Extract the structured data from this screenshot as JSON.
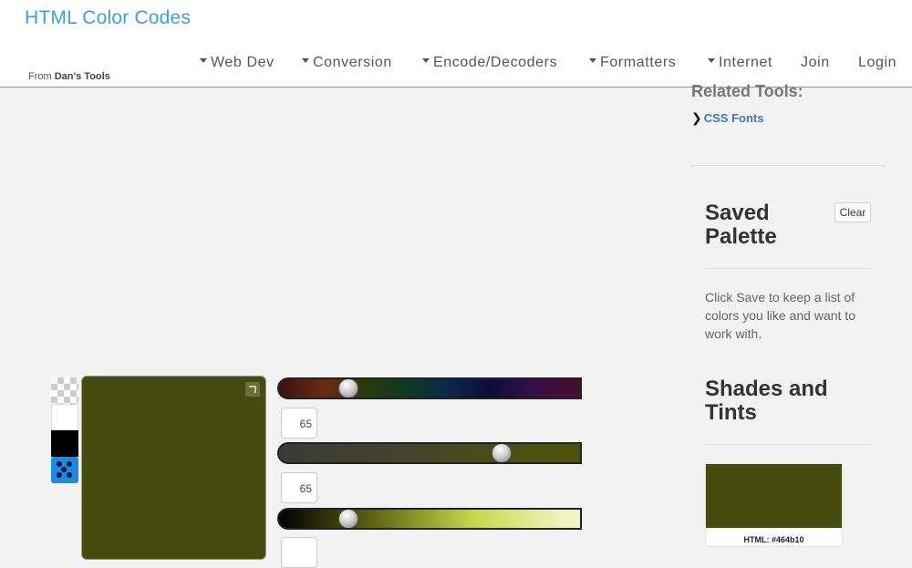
{
  "header": {
    "title": "HTML Color Codes",
    "from_prefix": "From",
    "from_site": "Dan's Tools",
    "nav": [
      {
        "label": "Web Dev",
        "dropdown": true
      },
      {
        "label": "Conversion",
        "dropdown": true
      },
      {
        "label": "Encode/Decoders",
        "dropdown": true
      },
      {
        "label": "Formatters",
        "dropdown": true
      },
      {
        "label": "Internet",
        "dropdown": true
      },
      {
        "label": "Join",
        "dropdown": false
      },
      {
        "label": "Login",
        "dropdown": false
      }
    ]
  },
  "picker": {
    "current_color": "#464b10",
    "hue_value": "65",
    "saturation_value": "65",
    "hue_fraction": 0.23,
    "saturation_fraction": 0.74,
    "lightness_fraction": 0.23,
    "swatches": [
      "transparent-swatch",
      "white-swatch",
      "black-swatch",
      "random-color-icon"
    ]
  },
  "sidebar": {
    "related_title": "Related Tools:",
    "related_links": [
      "CSS Fonts"
    ],
    "saved_palette_title": "Saved Palette",
    "clear_label": "Clear",
    "saved_palette_text": "Click Save to keep a list of colors you like and want to work with.",
    "shades_title": "Shades and Tints",
    "shades": [
      {
        "label": "HTML: #464b10",
        "color": "#464b10"
      }
    ]
  },
  "colors": {
    "brand": "#3e9fd8",
    "header_border": "#5aa6d6",
    "link": "#3a7ab8"
  }
}
